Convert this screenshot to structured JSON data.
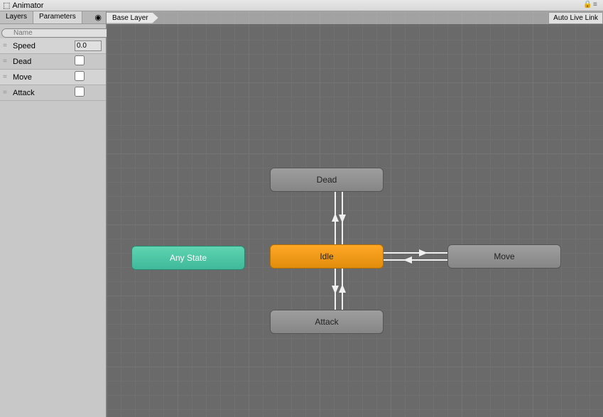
{
  "window": {
    "title": "Animator"
  },
  "sidebar": {
    "tabs": {
      "layers": "Layers",
      "parameters": "Parameters"
    },
    "search_placeholder": "Name",
    "add_label": "+",
    "parameters": [
      {
        "name": "Speed",
        "type": "float",
        "value": "0.0"
      },
      {
        "name": "Dead",
        "type": "bool",
        "value": false
      },
      {
        "name": "Move",
        "type": "bool",
        "value": false
      },
      {
        "name": "Attack",
        "type": "bool",
        "value": false
      }
    ]
  },
  "canvas": {
    "breadcrumb": "Base Layer",
    "autolive": "Auto Live Link",
    "nodes": {
      "anystate": "Any State",
      "dead": "Dead",
      "idle": "Idle",
      "move": "Move",
      "attack": "Attack"
    }
  }
}
